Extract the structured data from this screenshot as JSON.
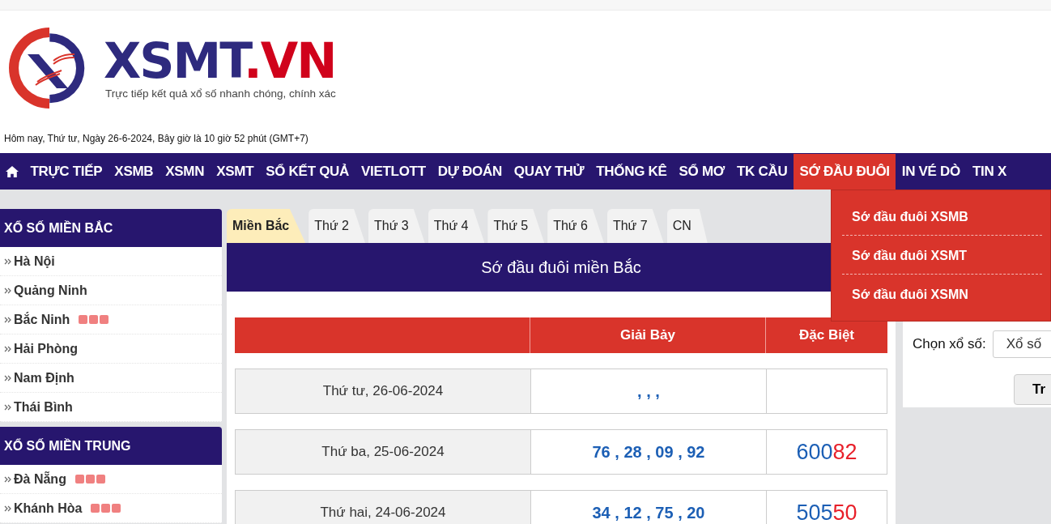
{
  "logo": {
    "name_main": "XSMT",
    "name_suffix": ".VN",
    "tagline": "Trực tiếp kết quả xổ số nhanh chóng, chính xác"
  },
  "date_line": "Hôm nay, Thứ tư, Ngày 26-6-2024, Bây giờ là 10 giờ 52 phút (GMT+7)",
  "nav": [
    {
      "label": "TRỰC TIẾP",
      "selected": false
    },
    {
      "label": "XSMB",
      "selected": false
    },
    {
      "label": "XSMN",
      "selected": false
    },
    {
      "label": "XSMT",
      "selected": false
    },
    {
      "label": "SỔ KẾT QUẢ",
      "selected": false
    },
    {
      "label": "VIETLOTT",
      "selected": false
    },
    {
      "label": "DỰ ĐOÁN",
      "selected": false
    },
    {
      "label": "QUAY THỬ",
      "selected": false
    },
    {
      "label": "THỐNG KÊ",
      "selected": false
    },
    {
      "label": "SỔ MƠ",
      "selected": false
    },
    {
      "label": "TK CẦU",
      "selected": false
    },
    {
      "label": "SỚ ĐẦU ĐUÔI",
      "selected": true
    },
    {
      "label": "IN VÉ DÒ",
      "selected": false
    },
    {
      "label": "TIN X",
      "selected": false
    }
  ],
  "dropdown": [
    "Sớ đầu đuôi XSMB",
    "Sớ đầu đuôi XSMT",
    "Sớ đầu đuôi XSMN"
  ],
  "sidebar": [
    {
      "title": "XỔ SỐ MIỀN BẮC",
      "items": [
        {
          "label": "Hà Nội",
          "live": false
        },
        {
          "label": "Quảng Ninh",
          "live": false
        },
        {
          "label": "Bắc Ninh",
          "live": true
        },
        {
          "label": "Hải Phòng",
          "live": false
        },
        {
          "label": "Nam Định",
          "live": false
        },
        {
          "label": "Thái Bình",
          "live": false
        }
      ]
    },
    {
      "title": "XỔ SỐ MIỀN TRUNG",
      "items": [
        {
          "label": "Đà Nẵng",
          "live": true
        },
        {
          "label": "Khánh Hòa",
          "live": true
        }
      ]
    }
  ],
  "tabs": [
    {
      "label": "Miền Bắc",
      "selected": true
    },
    {
      "label": "Thứ 2",
      "selected": false
    },
    {
      "label": "Thứ 3",
      "selected": false
    },
    {
      "label": "Thứ 4",
      "selected": false
    },
    {
      "label": "Thứ 5",
      "selected": false
    },
    {
      "label": "Thứ 6",
      "selected": false
    },
    {
      "label": "Thứ 7",
      "selected": false
    },
    {
      "label": "CN",
      "selected": false
    }
  ],
  "panel_title": "Sớ đầu đuôi miền Bắc",
  "table": {
    "columns": [
      "Giải Bảy",
      "Đặc Biệt"
    ],
    "rows": [
      {
        "date": "Thứ tư, 26-06-2024",
        "giai_bay": ", , ,"
      },
      {
        "date": "Thứ ba, 25-06-2024",
        "giai_bay": "76 , 28 , 09 , 92",
        "dac_biet": {
          "head": "600",
          "tail": "82"
        }
      },
      {
        "date": "Thứ hai, 24-06-2024",
        "giai_bay": "34 , 12 , 75 , 20",
        "dac_biet": {
          "head": "505",
          "tail": "50"
        }
      }
    ]
  },
  "right_panel": {
    "label": "Chọn xổ số:",
    "select_value": "Xổ số",
    "button": "Tr"
  }
}
